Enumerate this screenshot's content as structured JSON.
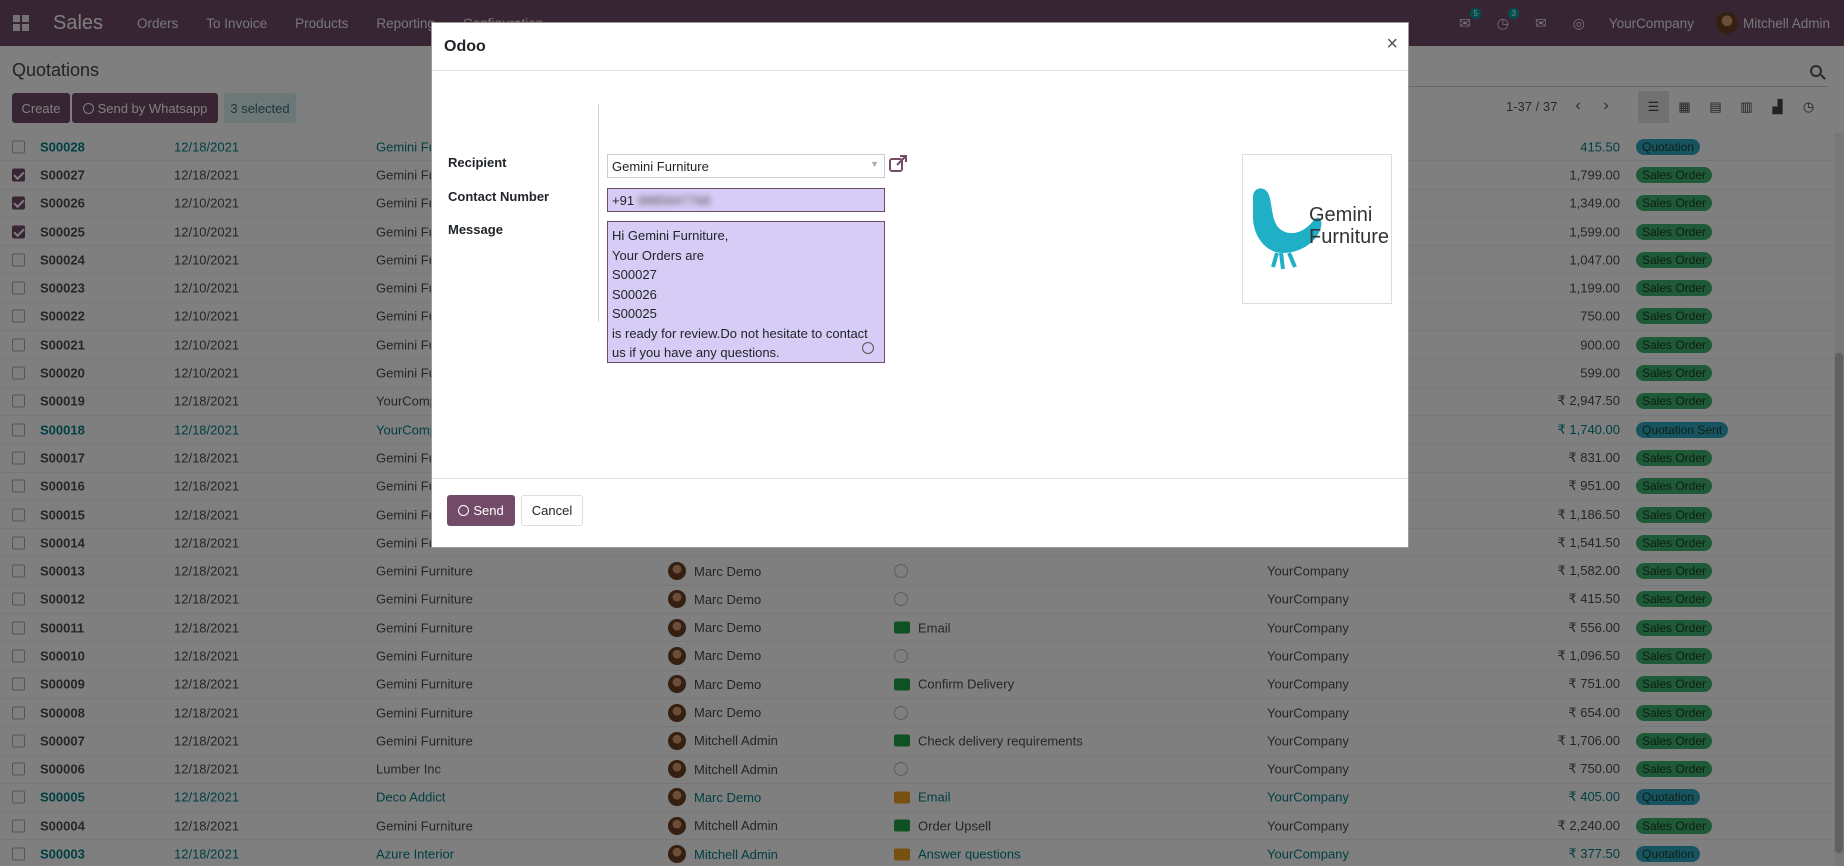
{
  "navbar": {
    "app_name": "Sales",
    "menu": [
      "Orders",
      "To Invoice",
      "Products",
      "Reporting",
      "Configuration"
    ],
    "chat_badge": "5",
    "activity_badge": "3",
    "company": "YourCompany",
    "user": "Mitchell Admin"
  },
  "control_panel": {
    "title": "Quotations",
    "create_label": "Create",
    "whatsapp_label": "Send by Whatsapp",
    "selected_label": "3 selected",
    "pager": "1-37 / 37"
  },
  "rows": [
    {
      "number": "S00028",
      "date": "12/18/2021",
      "customer": "Gemini Furniture",
      "salesperson": "",
      "activity": "",
      "company": "",
      "amount": "415.50",
      "status": "Quotation",
      "checked": false,
      "teal": true
    },
    {
      "number": "S00027",
      "date": "12/18/2021",
      "customer": "Gemini Furniture",
      "salesperson": "",
      "activity": "",
      "company": "",
      "amount": "1,799.00",
      "status": "Sales Order",
      "checked": true,
      "teal": false
    },
    {
      "number": "S00026",
      "date": "12/10/2021",
      "customer": "Gemini Furniture",
      "salesperson": "",
      "activity": "",
      "company": "",
      "amount": "1,349.00",
      "status": "Sales Order",
      "checked": true,
      "teal": false
    },
    {
      "number": "S00025",
      "date": "12/10/2021",
      "customer": "Gemini Furniture",
      "salesperson": "",
      "activity": "",
      "company": "",
      "amount": "1,599.00",
      "status": "Sales Order",
      "checked": true,
      "teal": false
    },
    {
      "number": "S00024",
      "date": "12/10/2021",
      "customer": "Gemini Furniture",
      "salesperson": "",
      "activity": "",
      "company": "",
      "amount": "1,047.00",
      "status": "Sales Order",
      "checked": false,
      "teal": false
    },
    {
      "number": "S00023",
      "date": "12/10/2021",
      "customer": "Gemini Furniture",
      "salesperson": "",
      "activity": "",
      "company": "",
      "amount": "1,199.00",
      "status": "Sales Order",
      "checked": false,
      "teal": false
    },
    {
      "number": "S00022",
      "date": "12/10/2021",
      "customer": "Gemini Furniture",
      "salesperson": "",
      "activity": "",
      "company": "",
      "amount": "750.00",
      "status": "Sales Order",
      "checked": false,
      "teal": false
    },
    {
      "number": "S00021",
      "date": "12/10/2021",
      "customer": "Gemini Furniture",
      "salesperson": "",
      "activity": "",
      "company": "",
      "amount": "900.00",
      "status": "Sales Order",
      "checked": false,
      "teal": false
    },
    {
      "number": "S00020",
      "date": "12/10/2021",
      "customer": "Gemini Furniture",
      "salesperson": "",
      "activity": "",
      "company": "",
      "amount": "599.00",
      "status": "Sales Order",
      "checked": false,
      "teal": false
    },
    {
      "number": "S00019",
      "date": "12/18/2021",
      "customer": "YourCompany",
      "salesperson": "",
      "activity": "",
      "company": "",
      "amount": "₹ 2,947.50",
      "status": "Sales Order",
      "checked": false,
      "teal": false
    },
    {
      "number": "S00018",
      "date": "12/18/2021",
      "customer": "YourCompany",
      "salesperson": "",
      "activity": "",
      "company": "",
      "amount": "₹ 1,740.00",
      "status": "Quotation Sent",
      "checked": false,
      "teal": true
    },
    {
      "number": "S00017",
      "date": "12/18/2021",
      "customer": "Gemini Furniture",
      "salesperson": "",
      "activity": "",
      "company": "",
      "amount": "₹ 831.00",
      "status": "Sales Order",
      "checked": false,
      "teal": false
    },
    {
      "number": "S00016",
      "date": "12/18/2021",
      "customer": "Gemini Furniture",
      "salesperson": "",
      "activity": "",
      "company": "",
      "amount": "₹ 951.00",
      "status": "Sales Order",
      "checked": false,
      "teal": false
    },
    {
      "number": "S00015",
      "date": "12/18/2021",
      "customer": "Gemini Furniture",
      "salesperson": "",
      "activity": "",
      "company": "",
      "amount": "₹ 1,186.50",
      "status": "Sales Order",
      "checked": false,
      "teal": false
    },
    {
      "number": "S00014",
      "date": "12/18/2021",
      "customer": "Gemini Furniture",
      "salesperson": "",
      "activity": "",
      "company": "",
      "amount": "₹ 1,541.50",
      "status": "Sales Order",
      "checked": false,
      "teal": false
    },
    {
      "number": "S00013",
      "date": "12/18/2021",
      "customer": "Gemini Furniture",
      "salesperson": "Marc Demo",
      "activity": "clock",
      "activity_label": "",
      "company": "YourCompany",
      "amount": "₹ 1,582.00",
      "status": "Sales Order",
      "checked": false,
      "teal": false
    },
    {
      "number": "S00012",
      "date": "12/18/2021",
      "customer": "Gemini Furniture",
      "salesperson": "Marc Demo",
      "activity": "clock",
      "activity_label": "",
      "company": "YourCompany",
      "amount": "₹ 415.50",
      "status": "Sales Order",
      "checked": false,
      "teal": false
    },
    {
      "number": "S00011",
      "date": "12/18/2021",
      "customer": "Gemini Furniture",
      "salesperson": "Marc Demo",
      "activity": "email",
      "activity_label": "Email",
      "company": "YourCompany",
      "amount": "₹ 556.00",
      "status": "Sales Order",
      "checked": false,
      "teal": false
    },
    {
      "number": "S00010",
      "date": "12/18/2021",
      "customer": "Gemini Furniture",
      "salesperson": "Marc Demo",
      "activity": "clock",
      "activity_label": "",
      "company": "YourCompany",
      "amount": "₹ 1,096.50",
      "status": "Sales Order",
      "checked": false,
      "teal": false
    },
    {
      "number": "S00009",
      "date": "12/18/2021",
      "customer": "Gemini Furniture",
      "salesperson": "Marc Demo",
      "activity": "todo",
      "activity_label": "Confirm Delivery",
      "company": "YourCompany",
      "amount": "₹ 751.00",
      "status": "Sales Order",
      "checked": false,
      "teal": false
    },
    {
      "number": "S00008",
      "date": "12/18/2021",
      "customer": "Gemini Furniture",
      "salesperson": "Marc Demo",
      "activity": "clock",
      "activity_label": "",
      "company": "YourCompany",
      "amount": "₹ 654.00",
      "status": "Sales Order",
      "checked": false,
      "teal": false
    },
    {
      "number": "S00007",
      "date": "12/18/2021",
      "customer": "Gemini Furniture",
      "salesperson": "Mitchell Admin",
      "activity": "todo",
      "activity_label": "Check delivery requirements",
      "company": "YourCompany",
      "amount": "₹ 1,706.00",
      "status": "Sales Order",
      "checked": false,
      "teal": false
    },
    {
      "number": "S00006",
      "date": "12/18/2021",
      "customer": "Lumber Inc",
      "salesperson": "Mitchell Admin",
      "activity": "clock",
      "activity_label": "",
      "company": "YourCompany",
      "amount": "₹ 750.00",
      "status": "Sales Order",
      "checked": false,
      "teal": false
    },
    {
      "number": "S00005",
      "date": "12/18/2021",
      "customer": "Deco Addict",
      "salesperson": "Marc Demo",
      "activity": "email-orange",
      "activity_label": "Email",
      "company": "YourCompany",
      "amount": "₹ 405.00",
      "status": "Quotation",
      "checked": false,
      "teal": true
    },
    {
      "number": "S00004",
      "date": "12/18/2021",
      "customer": "Gemini Furniture",
      "salesperson": "Mitchell Admin",
      "activity": "upsell",
      "activity_label": "Order Upsell",
      "company": "YourCompany",
      "amount": "₹ 2,240.00",
      "status": "Sales Order",
      "checked": false,
      "teal": false
    },
    {
      "number": "S00003",
      "date": "12/18/2021",
      "customer": "Azure Interior",
      "salesperson": "Mitchell Admin",
      "activity": "email-orange",
      "activity_label": "Answer questions",
      "company": "YourCompany",
      "amount": "₹ 377.50",
      "status": "Quotation",
      "checked": false,
      "teal": true
    }
  ],
  "status_colors": {
    "Sales Order": "#3cb371",
    "Quotation": "#2fa9c4",
    "Quotation Sent": "#2fa9c4"
  },
  "modal": {
    "title": "Odoo",
    "close": "×",
    "recipient_label": "Recipient",
    "recipient_value": "Gemini Furniture",
    "contact_label": "Contact Number",
    "contact_prefix": "+91",
    "contact_blurred": "9985647768",
    "message_label": "Message",
    "message_lines": [
      "Hi Gemini Furniture,",
      "Your Orders are",
      "S00027",
      "S00026",
      "S00025",
      "is ready for review.Do not hesitate to contact us if you have any questions."
    ],
    "logo_line1": "Gemini",
    "logo_line2": "Furniture",
    "send_label": "Send",
    "cancel_label": "Cancel"
  },
  "icons": {
    "apps": "grid-icon",
    "chat": "chat-icon",
    "activity": "clock-icon",
    "mail": "envelope-icon",
    "whatsapp": "whatsapp-icon",
    "search": "search-icon",
    "external": "external-link-icon"
  },
  "accent": "#714B67"
}
